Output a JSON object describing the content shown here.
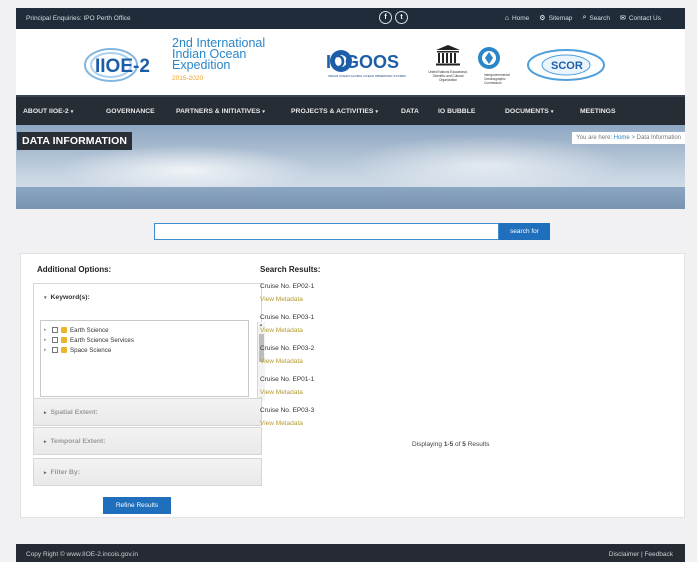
{
  "topbar": {
    "enquiries": "Principal Enquiries: IPO Perth Office",
    "social": [
      {
        "icon": "facebook-icon",
        "glyph": "f"
      },
      {
        "icon": "twitter-icon",
        "glyph": "t"
      }
    ],
    "links": [
      {
        "icon": "home-icon",
        "glyph": "⌂",
        "label": "Home"
      },
      {
        "icon": "sitemap-icon",
        "glyph": "⚙",
        "label": "Sitemap"
      },
      {
        "icon": "search-icon",
        "glyph": "⌕",
        "label": "Search"
      },
      {
        "icon": "mail-icon",
        "glyph": "✉",
        "label": "Contact Us"
      }
    ]
  },
  "header": {
    "logo_main": "IIOE-2",
    "tagline": [
      "2nd International",
      "Indian Ocean",
      "Expedition"
    ],
    "years": "2015-2020",
    "partner_goos": "IOGOOS",
    "partner_goos_sub": "INDIAN OCEAN GLOBAL OCEAN OBSERVING SYSTEM",
    "partner_unesco_caption": "United Nations Educational, Scientific and Cultural Organization",
    "partner_ioc_caption": "Intergovernmental Oceanographic Commission",
    "partner_scor": "SCOR",
    "colors": {
      "brand_blue": "#2a86c9",
      "accent_orange": "#f0a01e"
    }
  },
  "nav": {
    "items": [
      {
        "label": "ABOUT IIOE-2",
        "dropdown": true
      },
      {
        "label": "GOVERNANCE",
        "dropdown": false
      },
      {
        "label": "PARTNERS & INITIATIVES",
        "dropdown": true
      },
      {
        "label": "PROJECTS & ACTIVITIES",
        "dropdown": true
      },
      {
        "label": "DATA",
        "dropdown": false
      },
      {
        "label": "IO BUBBLE",
        "dropdown": false
      },
      {
        "label": "DOCUMENTS",
        "dropdown": true
      },
      {
        "label": "MEETINGS",
        "dropdown": false
      }
    ]
  },
  "banner": {
    "title": "DATA INFORMATION",
    "breadcrumb_prefix": "You are here:",
    "breadcrumb_home": "Home",
    "breadcrumb_sep": ">",
    "breadcrumb_current": "Data Information"
  },
  "search": {
    "value": "",
    "button": "search for"
  },
  "options": {
    "title": "Additional Options:",
    "keywords_label": "Keyword(s):",
    "tree": [
      "Earth Science",
      "Earth Science Services",
      "Space Science"
    ],
    "spatial_label": "Spatial Extent:",
    "temporal_label": "Temporal Extent:",
    "filter_label": "Filter By:",
    "refine_button": "Refine Results"
  },
  "results": {
    "title": "Search Results:",
    "items": [
      {
        "name": "Cruise No. EP02-1",
        "link": "View Metadata"
      },
      {
        "name": "Cruise No. EP03-1",
        "link": "View Metadata"
      },
      {
        "name": "Cruise No. EP03-2",
        "link": "View Metadata"
      },
      {
        "name": "Cruise No. EP01-1",
        "link": "View Metadata"
      },
      {
        "name": "Cruise No. EP03-3",
        "link": "View Metadata"
      }
    ],
    "displaying_prefix": "Displaying",
    "displaying_range": "1-5",
    "displaying_of": "of",
    "displaying_total": "5",
    "displaying_suffix": "Results"
  },
  "footer": {
    "copyright": "Copy Right © www.IIOE-2.incois.gov.in",
    "disclaimer": "Disclaimer",
    "sep": "|",
    "feedback": "Feedback"
  }
}
